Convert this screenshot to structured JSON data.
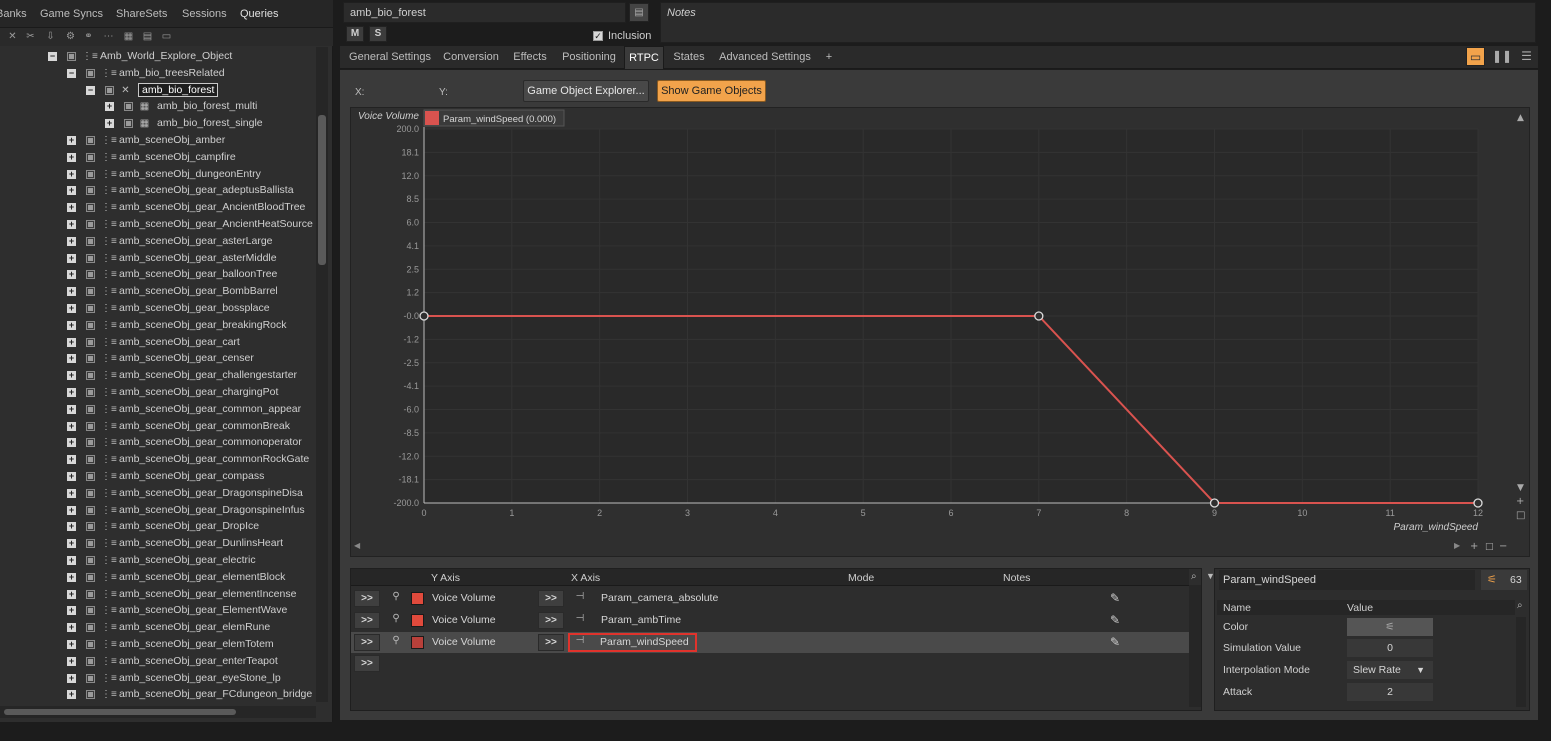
{
  "left_tabs": [
    "Banks",
    "Game Syncs",
    "ShareSets",
    "Sessions",
    "Queries"
  ],
  "tree": [
    {
      "label": "Amb_World_Explore_Object",
      "expander": "−",
      "icon": "actor-mixer-icon",
      "level": 0
    },
    {
      "label": "amb_bio_treesRelated",
      "expander": "−",
      "icon": "actor-mixer-icon",
      "level": 1
    },
    {
      "label": "amb_bio_forest",
      "expander": "−",
      "icon": "random-container-icon",
      "level": 2,
      "selected": true
    },
    {
      "label": "amb_bio_forest_multi",
      "expander": "+",
      "icon": "blend-container-icon",
      "level": 3
    },
    {
      "label": "amb_bio_forest_single",
      "expander": "+",
      "icon": "blend-container-icon",
      "level": 3
    },
    {
      "label": "amb_sceneObj_amber",
      "expander": "+",
      "icon": "actor-mixer-icon",
      "level": -1
    },
    {
      "label": "amb_sceneObj_campfire",
      "expander": "+",
      "icon": "actor-mixer-icon",
      "level": -1
    },
    {
      "label": "amb_sceneObj_dungeonEntry",
      "expander": "+",
      "icon": "actor-mixer-icon",
      "level": -1
    },
    {
      "label": "amb_sceneObj_gear_adeptusBallista",
      "expander": "+",
      "icon": "actor-mixer-icon",
      "level": -1
    },
    {
      "label": "amb_sceneObj_gear_AncientBloodTree",
      "expander": "+",
      "icon": "actor-mixer-icon",
      "level": -1
    },
    {
      "label": "amb_sceneObj_gear_AncientHeatSource",
      "expander": "+",
      "icon": "actor-mixer-icon",
      "level": -1
    },
    {
      "label": "amb_sceneObj_gear_asterLarge",
      "expander": "+",
      "icon": "actor-mixer-icon",
      "level": -1
    },
    {
      "label": "amb_sceneObj_gear_asterMiddle",
      "expander": "+",
      "icon": "actor-mixer-icon",
      "level": -1
    },
    {
      "label": "amb_sceneObj_gear_balloonTree",
      "expander": "+",
      "icon": "actor-mixer-icon",
      "level": -1
    },
    {
      "label": "amb_sceneObj_gear_BombBarrel",
      "expander": "+",
      "icon": "actor-mixer-icon",
      "level": -1
    },
    {
      "label": "amb_sceneObj_gear_bossplace",
      "expander": "+",
      "icon": "actor-mixer-icon",
      "level": -1
    },
    {
      "label": "amb_sceneObj_gear_breakingRock",
      "expander": "+",
      "icon": "actor-mixer-icon",
      "level": -1
    },
    {
      "label": "amb_sceneObj_gear_cart",
      "expander": "+",
      "icon": "actor-mixer-icon",
      "level": -1
    },
    {
      "label": "amb_sceneObj_gear_censer",
      "expander": "+",
      "icon": "actor-mixer-icon",
      "level": -1
    },
    {
      "label": "amb_sceneObj_gear_challengestarter",
      "expander": "+",
      "icon": "actor-mixer-icon",
      "level": -1
    },
    {
      "label": "amb_sceneObj_gear_chargingPot",
      "expander": "+",
      "icon": "actor-mixer-icon",
      "level": -1
    },
    {
      "label": "amb_sceneObj_gear_common_appear",
      "expander": "+",
      "icon": "actor-mixer-icon",
      "level": -1
    },
    {
      "label": "amb_sceneObj_gear_commonBreak",
      "expander": "+",
      "icon": "actor-mixer-icon",
      "level": -1
    },
    {
      "label": "amb_sceneObj_gear_commonoperator",
      "expander": "+",
      "icon": "actor-mixer-icon",
      "level": -1
    },
    {
      "label": "amb_sceneObj_gear_commonRockGate",
      "expander": "+",
      "icon": "actor-mixer-icon",
      "level": -1
    },
    {
      "label": "amb_sceneObj_gear_compass",
      "expander": "+",
      "icon": "actor-mixer-icon",
      "level": -1
    },
    {
      "label": "amb_sceneObj_gear_DragonspineDisa",
      "expander": "+",
      "icon": "actor-mixer-icon",
      "level": -1
    },
    {
      "label": "amb_sceneObj_gear_DragonspineInfus",
      "expander": "+",
      "icon": "actor-mixer-icon",
      "level": -1
    },
    {
      "label": "amb_sceneObj_gear_DropIce",
      "expander": "+",
      "icon": "actor-mixer-icon",
      "level": -1
    },
    {
      "label": "amb_sceneObj_gear_DunlinsHeart",
      "expander": "+",
      "icon": "actor-mixer-icon",
      "level": -1
    },
    {
      "label": "amb_sceneObj_gear_electric",
      "expander": "+",
      "icon": "actor-mixer-icon",
      "level": -1
    },
    {
      "label": "amb_sceneObj_gear_elementBlock",
      "expander": "+",
      "icon": "actor-mixer-icon",
      "level": -1
    },
    {
      "label": "amb_sceneObj_gear_elementIncense",
      "expander": "+",
      "icon": "actor-mixer-icon",
      "level": -1
    },
    {
      "label": "amb_sceneObj_gear_ElementWave",
      "expander": "+",
      "icon": "actor-mixer-icon",
      "level": -1
    },
    {
      "label": "amb_sceneObj_gear_elemRune",
      "expander": "+",
      "icon": "actor-mixer-icon",
      "level": -1
    },
    {
      "label": "amb_sceneObj_gear_elemTotem",
      "expander": "+",
      "icon": "actor-mixer-icon",
      "level": -1
    },
    {
      "label": "amb_sceneObj_gear_enterTeapot",
      "expander": "+",
      "icon": "actor-mixer-icon",
      "level": -1
    },
    {
      "label": "amb_sceneObj_gear_eyeStone_lp",
      "expander": "+",
      "icon": "actor-mixer-icon",
      "level": -1
    },
    {
      "label": "amb_sceneObj_gear_FCdungeon_bridge",
      "expander": "+",
      "icon": "actor-mixer-icon",
      "level": -1
    }
  ],
  "header": {
    "object_name": "amb_bio_forest",
    "mute_label": "M",
    "solo_label": "S",
    "inclusion_label": "Inclusion",
    "inclusion_checked": "✓",
    "notes_label": "Notes"
  },
  "tabs": [
    "General Settings",
    "Conversion",
    "Effects",
    "Positioning",
    "RTPC",
    "States",
    "Advanced Settings",
    "+"
  ],
  "active_tab": "RTPC",
  "toolbar": {
    "x_label": "X:",
    "y_label": "Y:",
    "x_value": "",
    "y_value": "",
    "game_object_explorer_label": "Game Object Explorer...",
    "show_game_objects_label": "Show Game Objects"
  },
  "chart_data": {
    "type": "line",
    "ylabel": "Voice Volume",
    "xlabel": "Param_windSpeed",
    "legend": "Param_windSpeed (0.000)",
    "x_ticks": [
      "0",
      "1",
      "2",
      "3",
      "4",
      "5",
      "6",
      "7",
      "8",
      "9",
      "10",
      "11",
      "12"
    ],
    "y_tick_labels": [
      "200.0",
      "18.1",
      "12.0",
      "8.5",
      "6.0",
      "4.1",
      "2.5",
      "1.2",
      "-0.0",
      "-1.2",
      "-2.5",
      "-4.1",
      "-6.0",
      "-8.5",
      "-12.0",
      "-18.1",
      "-200.0"
    ],
    "xlim": [
      0,
      12
    ],
    "series": [
      {
        "name": "Param_windSpeed",
        "color": "#d9534f",
        "points": [
          [
            0,
            0
          ],
          [
            7,
            0
          ],
          [
            9,
            -200
          ],
          [
            12,
            -200
          ]
        ]
      }
    ]
  },
  "curves_table": {
    "headers": {
      "y_axis": "Y Axis",
      "x_axis": "X Axis",
      "mode": "Mode",
      "notes": "Notes"
    },
    "rows": [
      {
        "y_axis": "Voice Volume",
        "x_axis": "Param_camera_absolute",
        "color": "#e04a3c",
        "selected": false
      },
      {
        "y_axis": "Voice Volume",
        "x_axis": "Param_ambTime",
        "color": "#e04a3c",
        "selected": false
      },
      {
        "y_axis": "Voice Volume",
        "x_axis": "Param_windSpeed",
        "color": "#b8403a",
        "selected": true
      }
    ],
    "add_label": ">>",
    "row_btn_label": ">>"
  },
  "property_panel": {
    "title": "Param_windSpeed",
    "count": "63",
    "headers": {
      "name": "Name",
      "value": "Value"
    },
    "rows": [
      {
        "name": "Color",
        "value": ""
      },
      {
        "name": "Simulation Value",
        "value": "0"
      },
      {
        "name": "Interpolation Mode",
        "value": "Slew Rate"
      },
      {
        "name": "Attack",
        "value": "2"
      }
    ]
  },
  "colors": {
    "accent": "#f2a34b",
    "curve": "#d9534f"
  }
}
